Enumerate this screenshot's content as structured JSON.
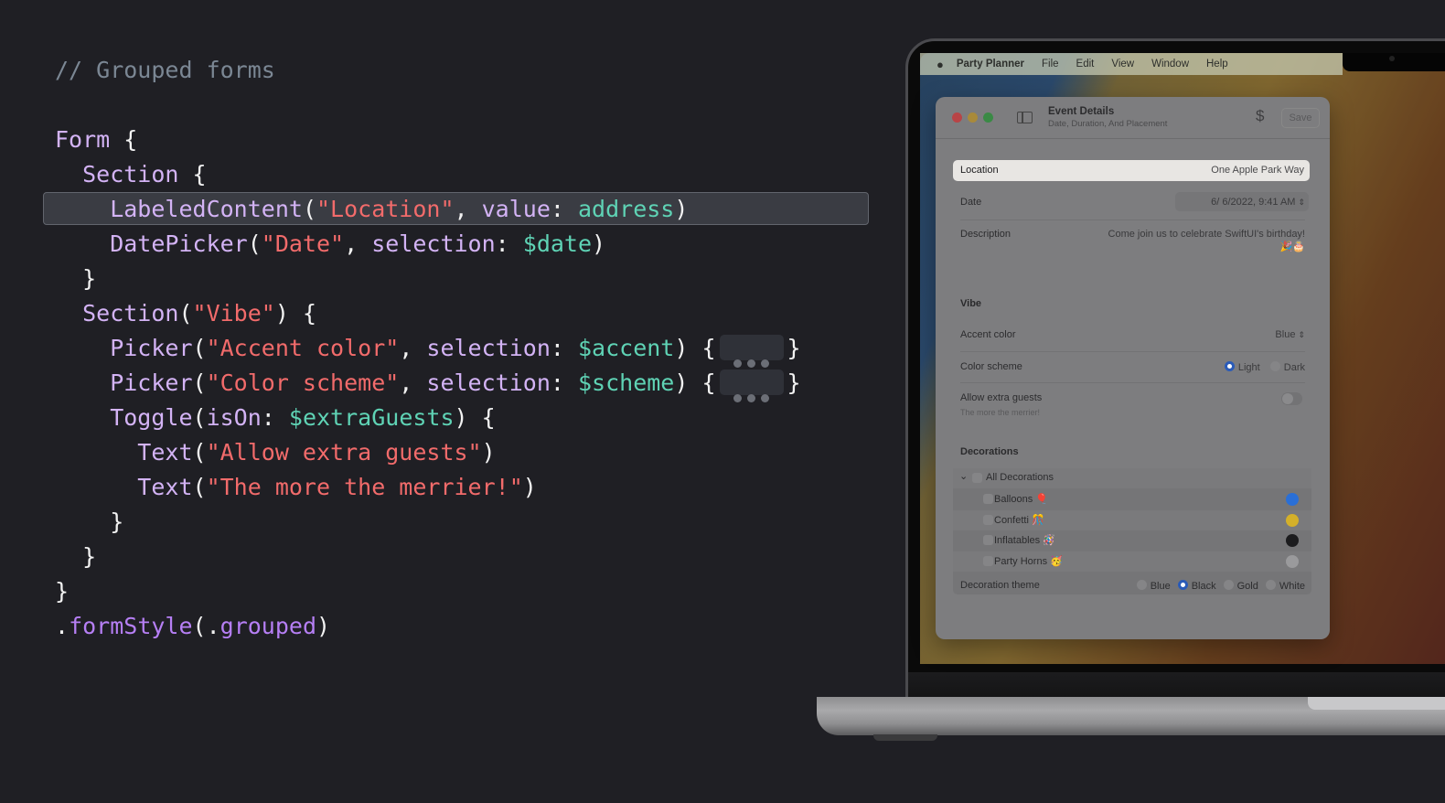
{
  "code": {
    "comment": "// Grouped forms",
    "lines": [
      [
        {
          "t": "Form",
          "c": "kw"
        },
        {
          "t": " {",
          "c": "plain"
        }
      ],
      [
        {
          "t": "  Section",
          "c": "kw"
        },
        {
          "t": " {",
          "c": "plain"
        }
      ],
      [
        {
          "t": "    LabeledContent",
          "c": "kw"
        },
        {
          "t": "(",
          "c": "plain"
        },
        {
          "t": "\"Location\"",
          "c": "str"
        },
        {
          "t": ", ",
          "c": "plain"
        },
        {
          "t": "value",
          "c": "kw"
        },
        {
          "t": ": ",
          "c": "plain"
        },
        {
          "t": "address",
          "c": "var"
        },
        {
          "t": ")",
          "c": "plain"
        }
      ],
      [
        {
          "t": "    DatePicker",
          "c": "kw"
        },
        {
          "t": "(",
          "c": "plain"
        },
        {
          "t": "\"Date\"",
          "c": "str"
        },
        {
          "t": ", ",
          "c": "plain"
        },
        {
          "t": "selection",
          "c": "kw"
        },
        {
          "t": ": ",
          "c": "plain"
        },
        {
          "t": "$date",
          "c": "var"
        },
        {
          "t": ")",
          "c": "plain"
        }
      ],
      [
        {
          "t": "  }",
          "c": "plain"
        }
      ],
      [
        {
          "t": "  Section",
          "c": "kw"
        },
        {
          "t": "(",
          "c": "plain"
        },
        {
          "t": "\"Vibe\"",
          "c": "str"
        },
        {
          "t": ") {",
          "c": "plain"
        }
      ],
      [
        {
          "t": "    Picker",
          "c": "kw"
        },
        {
          "t": "(",
          "c": "plain"
        },
        {
          "t": "\"Accent color\"",
          "c": "str"
        },
        {
          "t": ", ",
          "c": "plain"
        },
        {
          "t": "selection",
          "c": "kw"
        },
        {
          "t": ": ",
          "c": "plain"
        },
        {
          "t": "$accent",
          "c": "var"
        },
        {
          "t": ") {",
          "c": "plain"
        },
        {
          "t": "…",
          "c": "ellipsis"
        },
        {
          "t": "}",
          "c": "plain"
        }
      ],
      [
        {
          "t": "    Picker",
          "c": "kw"
        },
        {
          "t": "(",
          "c": "plain"
        },
        {
          "t": "\"Color scheme\"",
          "c": "str"
        },
        {
          "t": ", ",
          "c": "plain"
        },
        {
          "t": "selection",
          "c": "kw"
        },
        {
          "t": ": ",
          "c": "plain"
        },
        {
          "t": "$scheme",
          "c": "var"
        },
        {
          "t": ") {",
          "c": "plain"
        },
        {
          "t": "…",
          "c": "ellipsis"
        },
        {
          "t": "}",
          "c": "plain"
        }
      ],
      [
        {
          "t": "    Toggle",
          "c": "kw"
        },
        {
          "t": "(",
          "c": "plain"
        },
        {
          "t": "isOn",
          "c": "kw"
        },
        {
          "t": ": ",
          "c": "plain"
        },
        {
          "t": "$extraGuests",
          "c": "var"
        },
        {
          "t": ") {",
          "c": "plain"
        }
      ],
      [
        {
          "t": "      Text",
          "c": "kw"
        },
        {
          "t": "(",
          "c": "plain"
        },
        {
          "t": "\"Allow extra guests\"",
          "c": "str"
        },
        {
          "t": ")",
          "c": "plain"
        }
      ],
      [
        {
          "t": "      Text",
          "c": "kw"
        },
        {
          "t": "(",
          "c": "plain"
        },
        {
          "t": "\"The more the merrier!\"",
          "c": "str"
        },
        {
          "t": ")",
          "c": "plain"
        }
      ],
      [
        {
          "t": "    }",
          "c": "plain"
        }
      ],
      [
        {
          "t": "  }",
          "c": "plain"
        }
      ],
      [
        {
          "t": "}",
          "c": "plain"
        }
      ],
      [
        {
          "t": ".",
          "c": "plain"
        },
        {
          "t": "formStyle",
          "c": "mod"
        },
        {
          "t": "(.",
          "c": "plain"
        },
        {
          "t": "grouped",
          "c": "mod"
        },
        {
          "t": ")",
          "c": "plain"
        }
      ]
    ],
    "highlighted_line": 2
  },
  "menubar": {
    "apple": "",
    "app_name": "Party Planner",
    "items": [
      "File",
      "Edit",
      "View",
      "Window",
      "Help"
    ]
  },
  "window": {
    "title": "Event Details",
    "subtitle": "Date, Duration, And Placement",
    "dollar_icon": "$",
    "save_label": "Save"
  },
  "form": {
    "location": {
      "label": "Location",
      "value": "One Apple Park Way"
    },
    "date": {
      "label": "Date",
      "value": "6/  6/2022,  9:41 AM",
      "stepper": "⇕"
    },
    "description": {
      "label": "Description",
      "value": "Come join us to celebrate SwiftUI's birthday!",
      "emoji": "🎉🎂"
    },
    "vibe": {
      "header": "Vibe",
      "accent": {
        "label": "Accent color",
        "value": "Blue",
        "stepper": "⇕"
      },
      "scheme": {
        "label": "Color scheme",
        "options": [
          "Light",
          "Dark"
        ],
        "selected": "Light"
      },
      "guests": {
        "label": "Allow extra guests",
        "sublabel": "The more the merrier!",
        "on": false
      }
    },
    "decorations": {
      "header": "Decorations",
      "all_label": "All Decorations",
      "chevron": "⌄",
      "items": [
        {
          "label": "Balloons 🎈",
          "color": "#2a6fd6"
        },
        {
          "label": "Confetti 🎊",
          "color": "#d4b02a"
        },
        {
          "label": "Inflatables 🪅",
          "color": "#1c1c1e"
        },
        {
          "label": "Party Horns 🥳",
          "color": "#9a9a9c"
        }
      ],
      "theme": {
        "label": "Decoration theme",
        "options": [
          "Blue",
          "Black",
          "Gold",
          "White"
        ],
        "selected": "Black"
      }
    }
  }
}
